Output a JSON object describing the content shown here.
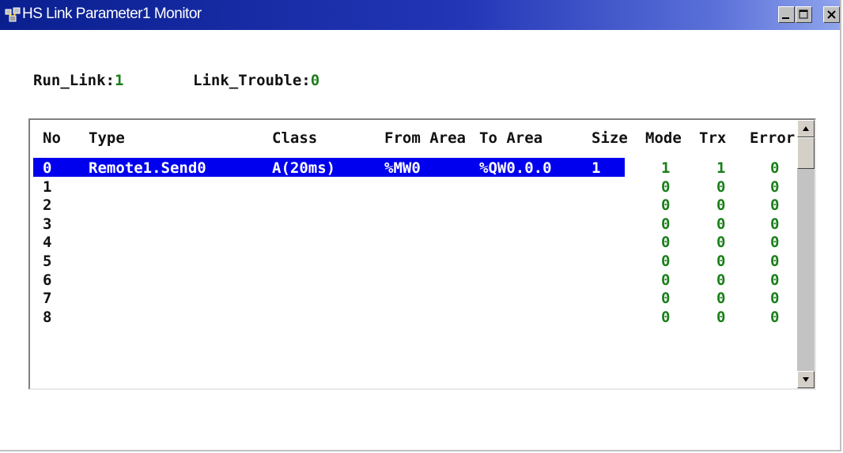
{
  "window": {
    "title": "HS Link Parameter1 Monitor",
    "icon": "network-monitor-icon"
  },
  "status": {
    "run_link_label": "Run_Link:",
    "run_link_value": "1",
    "link_trouble_label": "Link_Trouble:",
    "link_trouble_value": "0"
  },
  "table": {
    "headers": {
      "no": "No",
      "type": "Type",
      "class": "Class",
      "from_area": "From Area",
      "to_area": "To Area",
      "size": "Size",
      "mode": "Mode",
      "trx": "Trx",
      "error": "Error"
    },
    "selected_row": 0,
    "rows": [
      {
        "no": "0",
        "type": "Remote1.Send0",
        "class": "A(20ms)",
        "from": "%MW0",
        "to": "%QW0.0.0",
        "size": "1",
        "mode": "1",
        "trx": "1",
        "error": "0"
      },
      {
        "no": "1",
        "type": "",
        "class": "",
        "from": "",
        "to": "",
        "size": "",
        "mode": "0",
        "trx": "0",
        "error": "0"
      },
      {
        "no": "2",
        "type": "",
        "class": "",
        "from": "",
        "to": "",
        "size": "",
        "mode": "0",
        "trx": "0",
        "error": "0"
      },
      {
        "no": "3",
        "type": "",
        "class": "",
        "from": "",
        "to": "",
        "size": "",
        "mode": "0",
        "trx": "0",
        "error": "0"
      },
      {
        "no": "4",
        "type": "",
        "class": "",
        "from": "",
        "to": "",
        "size": "",
        "mode": "0",
        "trx": "0",
        "error": "0"
      },
      {
        "no": "5",
        "type": "",
        "class": "",
        "from": "",
        "to": "",
        "size": "",
        "mode": "0",
        "trx": "0",
        "error": "0"
      },
      {
        "no": "6",
        "type": "",
        "class": "",
        "from": "",
        "to": "",
        "size": "",
        "mode": "0",
        "trx": "0",
        "error": "0"
      },
      {
        "no": "7",
        "type": "",
        "class": "",
        "from": "",
        "to": "",
        "size": "",
        "mode": "0",
        "trx": "0",
        "error": "0"
      },
      {
        "no": "8",
        "type": "",
        "class": "",
        "from": "",
        "to": "",
        "size": "",
        "mode": "0",
        "trx": "0",
        "error": "0"
      }
    ]
  },
  "colors": {
    "title_bar": "#0a1f8f",
    "selection": "#0000ee",
    "value_green": "#1a7f1a"
  }
}
